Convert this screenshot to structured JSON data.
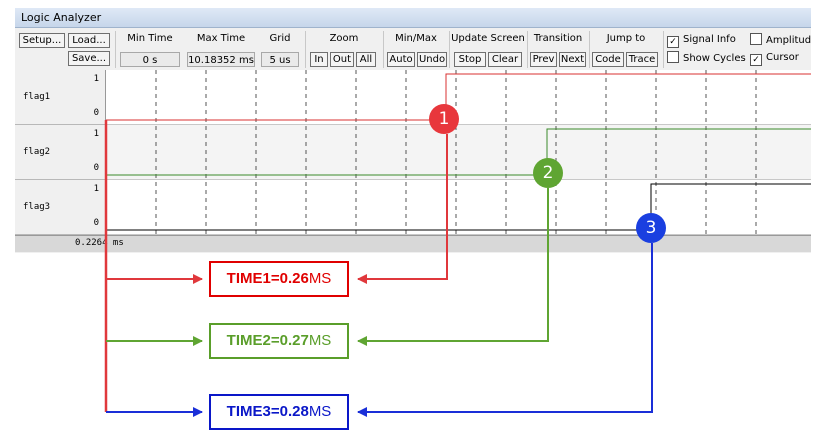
{
  "window": {
    "title": "Logic Analyzer"
  },
  "toolbar": {
    "setup_label": "Setup...",
    "load_label": "Load...",
    "save_label": "Save...",
    "min_time": {
      "label": "Min Time",
      "value": "0 s"
    },
    "max_time": {
      "label": "Max Time",
      "value": "10.18352 ms"
    },
    "grid": {
      "label": "Grid",
      "value": "5 us"
    },
    "zoom": {
      "label": "Zoom",
      "in": "In",
      "out": "Out",
      "all": "All"
    },
    "minmax": {
      "label": "Min/Max",
      "auto": "Auto",
      "undo": "Undo"
    },
    "update": {
      "label": "Update Screen",
      "stop": "Stop",
      "clear": "Clear"
    },
    "transition": {
      "label": "Transition",
      "prev": "Prev",
      "next": "Next"
    },
    "jumpto": {
      "label": "Jump to",
      "code": "Code",
      "trace": "Trace"
    },
    "signal_info": {
      "label": "Signal Info",
      "checked": true
    },
    "show_cycles": {
      "label": "Show Cycles",
      "checked": false
    },
    "amplitude": {
      "label": "Amplitude",
      "checked": false
    },
    "cursor": {
      "label": "Cursor",
      "checked": true
    }
  },
  "signals": [
    {
      "name": "flag1",
      "high": "1",
      "low": "0"
    },
    {
      "name": "flag2",
      "high": "1",
      "low": "0"
    },
    {
      "name": "flag3",
      "high": "1",
      "low": "0"
    }
  ],
  "status": {
    "cursor_time": "0.2264 ms"
  },
  "markers": [
    {
      "number": "1",
      "color": "#e8373c"
    },
    {
      "number": "2",
      "color": "#5fa532"
    },
    {
      "number": "3",
      "color": "#1a3fe0"
    }
  ],
  "annotations": [
    {
      "key": "TIME1=0.26",
      "unit": "MS",
      "color": "#e00000",
      "unit_color": "#e00000"
    },
    {
      "key": "TIME2=0.27",
      "unit": "MS",
      "color": "#5a9e2a",
      "unit_color": "#5a9e2a"
    },
    {
      "key": "TIME3=0.28",
      "unit": "MS",
      "color": "#0a17c8",
      "unit_color": "#0a17c8"
    }
  ],
  "colors": {
    "red": "#e0383c",
    "green": "#5fa532",
    "blue": "#1a2fd8"
  }
}
